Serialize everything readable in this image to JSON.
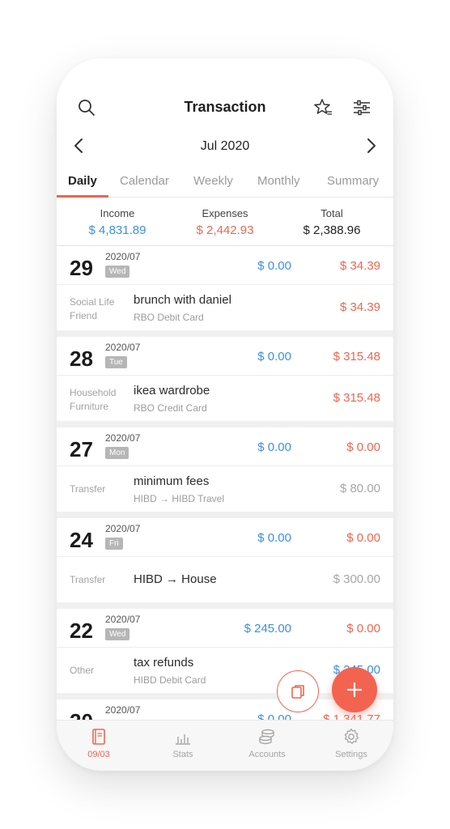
{
  "header": {
    "title": "Transaction",
    "month": "Jul 2020"
  },
  "tabs": [
    {
      "label": "Daily",
      "active": true
    },
    {
      "label": "Calendar",
      "active": false
    },
    {
      "label": "Weekly",
      "active": false
    },
    {
      "label": "Monthly",
      "active": false
    },
    {
      "label": "Summary",
      "active": false
    }
  ],
  "summary": {
    "income_label": "Income",
    "income_value": "$ 4,831.89",
    "expenses_label": "Expenses",
    "expenses_value": "$ 2,442.93",
    "total_label": "Total",
    "total_value": "$ 2,388.96"
  },
  "days": [
    {
      "day": "29",
      "year_month": "2020/07",
      "weekday": "Wed",
      "income": "$ 0.00",
      "expense": "$ 34.39",
      "transactions": [
        {
          "category": "Social Life",
          "subcategory": "Friend",
          "name": "brunch with daniel",
          "account": "RBO Debit Card",
          "amount": "$ 34.39"
        }
      ]
    },
    {
      "day": "28",
      "year_month": "2020/07",
      "weekday": "Tue",
      "income": "$ 0.00",
      "expense": "$ 315.48",
      "transactions": [
        {
          "category": "Household",
          "subcategory": "Furniture",
          "name": "ikea wardrobe",
          "account": "RBO Credit Card",
          "amount": "$ 315.48"
        }
      ]
    },
    {
      "day": "27",
      "year_month": "2020/07",
      "weekday": "Mon",
      "income": "$ 0.00",
      "expense": "$ 0.00",
      "transactions": [
        {
          "category": "Transfer",
          "name": "minimum fees",
          "account": "HIBD → HIBD Travel",
          "amount": "$ 80.00"
        }
      ]
    },
    {
      "day": "24",
      "year_month": "2020/07",
      "weekday": "Fri",
      "income": "$ 0.00",
      "expense": "$ 0.00",
      "transactions": [
        {
          "category": "Transfer",
          "name": "HIBD → House",
          "amount": "$ 300.00"
        }
      ]
    },
    {
      "day": "22",
      "year_month": "2020/07",
      "weekday": "Wed",
      "income": "$ 245.00",
      "expense": "$ 0.00",
      "transactions": [
        {
          "category": "Other",
          "name": "tax refunds",
          "account": "HIBD Debit Card",
          "amount": "$ 245.00"
        }
      ]
    },
    {
      "day": "20",
      "year_month": "2020/07",
      "weekday": "",
      "income": "$ 0.00",
      "expense": "$ 1,341.77",
      "transactions": []
    }
  ],
  "bottom_nav": [
    {
      "label": "09/03",
      "icon": "book-icon",
      "active": true
    },
    {
      "label": "Stats",
      "icon": "bar-chart-icon",
      "active": false
    },
    {
      "label": "Accounts",
      "icon": "coins-icon",
      "active": false
    },
    {
      "label": "Settings",
      "icon": "gear-icon",
      "active": false
    }
  ],
  "colors": {
    "accent": "#f26450",
    "income": "#3b8fe6",
    "expense": "#f26450"
  }
}
